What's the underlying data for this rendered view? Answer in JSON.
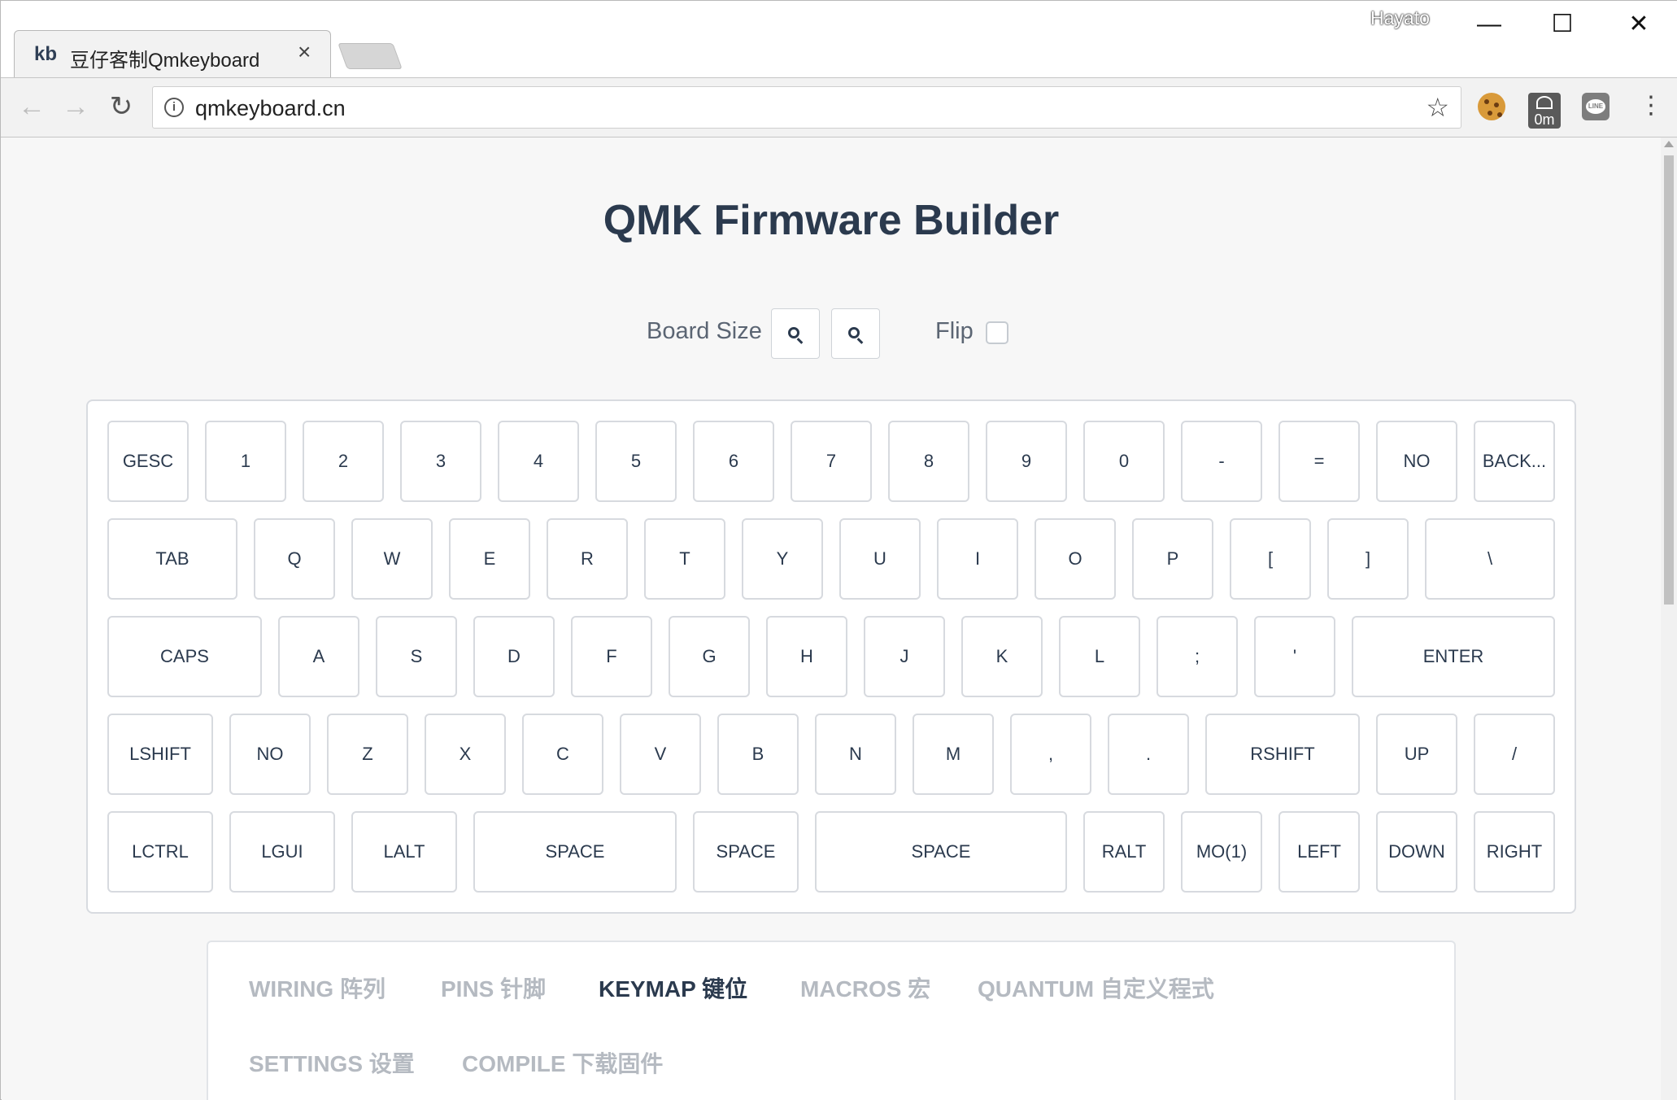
{
  "browser": {
    "tab_favicon": "kb",
    "tab_title": "豆仔客制Qmkeyboard",
    "tab_close": "×",
    "profile": "Hayato",
    "url": "qmkeyboard.cn",
    "info_icon": "i",
    "star_icon": "☆",
    "back_icon": "←",
    "forward_icon": "→",
    "reload_icon": "↻",
    "minimize_icon": "—",
    "maximize_icon": "☐",
    "close_icon": "✕",
    "menu_icon": "⋮",
    "extensions": [
      "cookie-icon",
      "clock-icon",
      "line-icon"
    ],
    "clock_label": "0m",
    "line_label": "LINE"
  },
  "page": {
    "title": "QMK Firmware Builder",
    "board_size_label": "Board Size",
    "flip_label": "Flip",
    "flip_checked": false
  },
  "keyboard": {
    "rows": [
      [
        "GESC",
        "1",
        "2",
        "3",
        "4",
        "5",
        "6",
        "7",
        "8",
        "9",
        "0",
        "-",
        "=",
        "NO",
        "BACK..."
      ],
      [
        "TAB",
        "Q",
        "W",
        "E",
        "R",
        "T",
        "Y",
        "U",
        "I",
        "O",
        "P",
        "[",
        "]",
        "\\"
      ],
      [
        "CAPS",
        "A",
        "S",
        "D",
        "F",
        "G",
        "H",
        "J",
        "K",
        "L",
        ";",
        "'",
        "ENTER"
      ],
      [
        "LSHIFT",
        "NO",
        "Z",
        "X",
        "C",
        "V",
        "B",
        "N",
        "M",
        ",",
        ".",
        "RSHIFT",
        "UP",
        "/"
      ],
      [
        "LCTRL",
        "LGUI",
        "LALT",
        "SPACE",
        "SPACE",
        "SPACE",
        "RALT",
        "MO(1)",
        "LEFT",
        "DOWN",
        "RIGHT"
      ]
    ],
    "widths": [
      [
        1,
        1,
        1,
        1,
        1,
        1,
        1,
        1,
        1,
        1,
        1,
        1,
        1,
        1,
        1
      ],
      [
        1.5,
        1,
        1,
        1,
        1,
        1,
        1,
        1,
        1,
        1,
        1,
        1,
        1,
        1.5
      ],
      [
        1.75,
        1,
        1,
        1,
        1,
        1,
        1,
        1,
        1,
        1,
        1,
        1,
        2.25
      ],
      [
        1.25,
        1,
        1,
        1,
        1,
        1,
        1,
        1,
        1,
        1,
        1,
        1.75,
        1,
        1
      ],
      [
        1.25,
        1.25,
        1.25,
        2.25,
        1.25,
        2.75,
        1,
        1,
        1,
        1,
        1
      ]
    ]
  },
  "tabs": [
    {
      "label": "WIRING 阵列",
      "active": false
    },
    {
      "label": "PINS 针脚",
      "active": false
    },
    {
      "label": "KEYMAP 键位",
      "active": true
    },
    {
      "label": "MACROS 宏",
      "active": false
    },
    {
      "label": "QUANTUM 自定义程式",
      "active": false
    },
    {
      "label": "SETTINGS 设置",
      "active": false
    },
    {
      "label": "COMPILE 下载固件",
      "active": false
    }
  ]
}
